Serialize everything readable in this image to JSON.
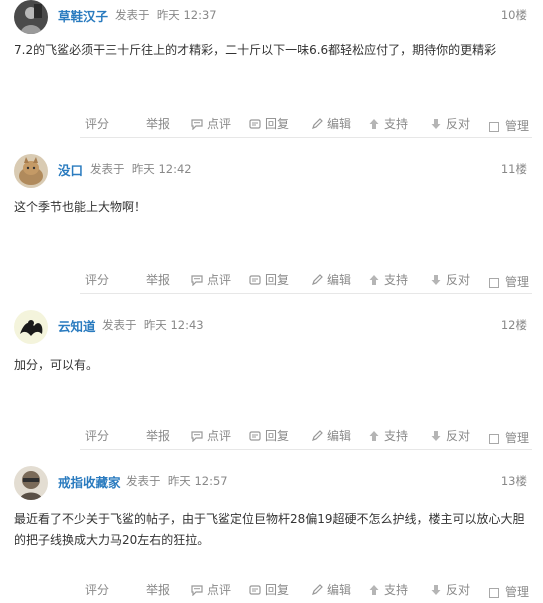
{
  "posts": [
    {
      "author": "草鞋汉子",
      "posted_label": "发表于",
      "time": "昨天 12:37",
      "floor": "10楼",
      "content_lines": [
        "7.2的飞鲨必须干三十斤往上的才精彩，二十斤以下一味6.6都轻松应付了，期待你的更精彩"
      ]
    },
    {
      "author": "没口",
      "posted_label": "发表于",
      "time": "昨天 12:42",
      "floor": "11楼",
      "content_lines": [
        "这个季节也能上大物啊！"
      ]
    },
    {
      "author": "云知道",
      "posted_label": "发表于",
      "time": "昨天 12:43",
      "floor": "12楼",
      "content_lines": [
        "加分，可以有。"
      ]
    },
    {
      "author": "戒指收藏家",
      "posted_label": "发表于",
      "time": "昨天 12:57",
      "floor": "13楼",
      "content_lines": [
        "最近看了不少关于飞鲨的帖子，由于飞鲨定位巨物杆28偏19超硬不怎么护线，楼主可以放心大胆",
        "的把子线换成大力马20左右的狂拉。"
      ]
    }
  ],
  "actions": {
    "rate": "评分",
    "report": "举报",
    "comment": "点评",
    "reply": "回复",
    "edit": "编辑",
    "support": "支持",
    "oppose": "反对",
    "manage": "管理"
  },
  "colors": {
    "author": "#2a7bbf",
    "meta": "#888888",
    "action": "#8a8a8a",
    "divider": "#e7e7e7"
  },
  "icons": {
    "comment": "chat-bubble-icon",
    "reply": "reply-icon",
    "edit": "pencil-icon",
    "support": "thumb-up-arrow-icon",
    "oppose": "thumb-down-arrow-icon",
    "manage": "checkbox-icon"
  }
}
